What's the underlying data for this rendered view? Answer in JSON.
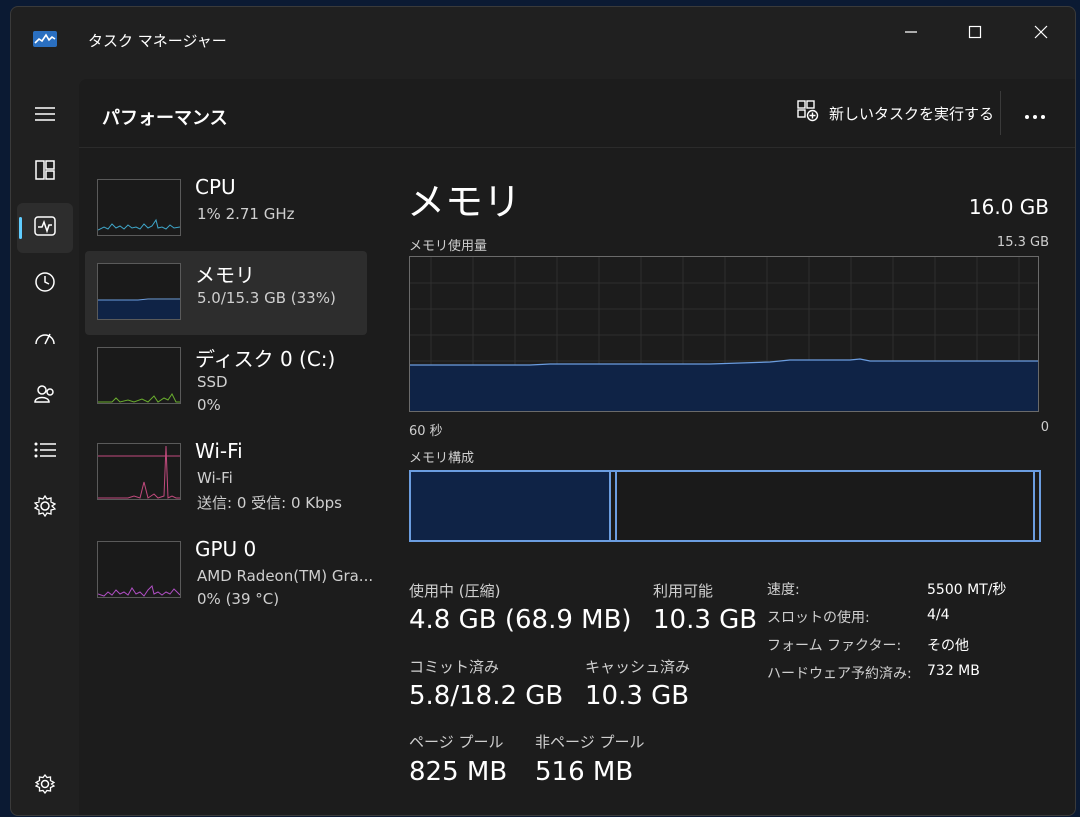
{
  "window": {
    "title": "タスク マネージャー"
  },
  "icons": {
    "app": "task-manager-icon",
    "minimize": "minimize-icon",
    "maximize": "maximize-icon",
    "close": "close-icon",
    "nav": [
      "hamburger-icon",
      "processes-icon",
      "performance-icon",
      "app-history-icon",
      "startup-icon",
      "users-icon",
      "details-icon",
      "services-icon"
    ],
    "settings": "gear-icon",
    "new_task": "new-task-icon",
    "more": "more-icon"
  },
  "header": {
    "title": "パフォーマンス",
    "new_task_label": "新しいタスクを実行する"
  },
  "resources": [
    {
      "name": "CPU",
      "line1": "1%  2.71 GHz",
      "line2": ""
    },
    {
      "name": "メモリ",
      "line1": "5.0/15.3 GB (33%)",
      "line2": ""
    },
    {
      "name": "ディスク 0 (C:)",
      "line1": "SSD",
      "line2": "0%"
    },
    {
      "name": "Wi-Fi",
      "line1": "Wi-Fi",
      "line2": "送信: 0  受信: 0 Kbps"
    },
    {
      "name": "GPU 0",
      "line1": "AMD Radeon(TM) Gra...",
      "line2": "0%  (39 °C)"
    }
  ],
  "detail": {
    "title": "メモリ",
    "total": "16.0 GB",
    "usage_label": "メモリ使用量",
    "usage_max": "15.3 GB",
    "time_left": "60 秒",
    "time_right": "0",
    "composition_label": "メモリ構成",
    "stats": {
      "in_use_label": "使用中 (圧縮)",
      "in_use_value": "4.8 GB (68.9 MB)",
      "available_label": "利用可能",
      "available_value": "10.3 GB",
      "committed_label": "コミット済み",
      "committed_value": "5.8/18.2 GB",
      "cached_label": "キャッシュ済み",
      "cached_value": "10.3 GB",
      "paged_label": "ページ プール",
      "paged_value": "825 MB",
      "nonpaged_label": "非ページ プール",
      "nonpaged_value": "516 MB"
    },
    "specs": [
      {
        "key": "速度:",
        "value": "5500 MT/秒"
      },
      {
        "key": "スロットの使用:",
        "value": "4/4"
      },
      {
        "key": "フォーム ファクター:",
        "value": "その他"
      },
      {
        "key": "ハードウェア予約済み:",
        "value": "732 MB"
      }
    ]
  },
  "colors": {
    "accent": "#60cdff",
    "memory_line": "#6b9de0",
    "memory_fill": "#0f2346",
    "cpu": "#3fa6c9",
    "disk": "#6aae2e",
    "wifi": "#c24a7d",
    "gpu": "#b04fc4"
  }
}
